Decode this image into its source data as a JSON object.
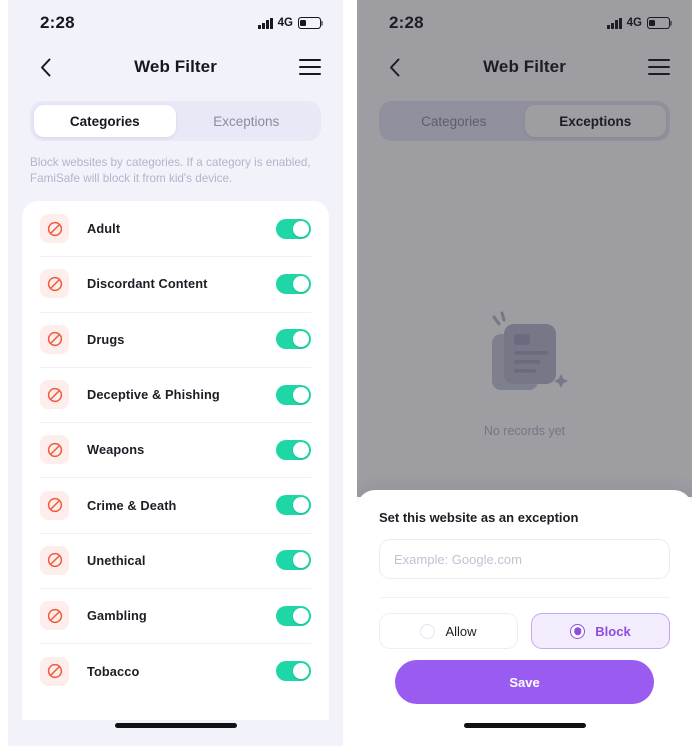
{
  "theme": {
    "accent_purple": "#9a5cf0",
    "toggle_green": "#1fd6a6",
    "ban_red": "#f05a3c",
    "page_bg": "#f2f2fb"
  },
  "status_bar": {
    "time": "2:28",
    "network": "4G"
  },
  "nav": {
    "title": "Web Filter",
    "back_icon": "chevron-left-icon",
    "menu_icon": "hamburger-menu-icon"
  },
  "left_screen": {
    "tabs": [
      {
        "label": "Categories",
        "active": true
      },
      {
        "label": "Exceptions",
        "active": false
      }
    ],
    "description": "Block websites by categories. If a category is enabled, FamiSafe will block it from kid's device.",
    "categories": [
      {
        "label": "Adult",
        "enabled": true
      },
      {
        "label": "Discordant Content",
        "enabled": true
      },
      {
        "label": "Drugs",
        "enabled": true
      },
      {
        "label": "Deceptive & Phishing",
        "enabled": true
      },
      {
        "label": "Weapons",
        "enabled": true
      },
      {
        "label": "Crime & Death",
        "enabled": true
      },
      {
        "label": "Unethical",
        "enabled": true
      },
      {
        "label": "Gambling",
        "enabled": true
      },
      {
        "label": "Tobacco",
        "enabled": true
      }
    ]
  },
  "right_screen": {
    "tabs": [
      {
        "label": "Categories",
        "active": false
      },
      {
        "label": "Exceptions",
        "active": true
      }
    ],
    "empty_state": {
      "label": "No records yet",
      "icon": "documents-empty-icon"
    },
    "sheet": {
      "title": "Set this website as an exception",
      "input_placeholder": "Example: Google.com",
      "input_value": "",
      "options": [
        {
          "label": "Allow",
          "selected": false
        },
        {
          "label": "Block",
          "selected": true
        }
      ],
      "save_label": "Save"
    }
  }
}
